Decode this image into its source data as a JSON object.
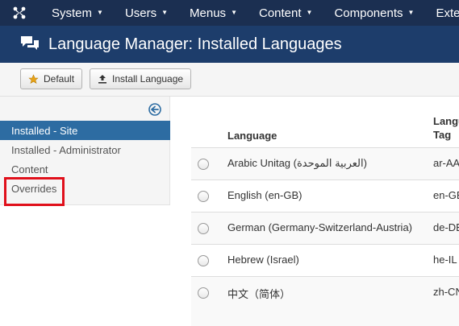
{
  "topnav": {
    "items": [
      {
        "label": "System"
      },
      {
        "label": "Users"
      },
      {
        "label": "Menus"
      },
      {
        "label": "Content"
      },
      {
        "label": "Components"
      },
      {
        "label": "Extensions"
      }
    ]
  },
  "header": {
    "title": "Language Manager: Installed Languages"
  },
  "toolbar": {
    "default_label": "Default",
    "install_label": "Install Language"
  },
  "sidebar": {
    "items": [
      {
        "label": "Installed - Site",
        "active": true
      },
      {
        "label": "Installed - Administrator",
        "active": false
      },
      {
        "label": "Content",
        "active": false
      },
      {
        "label": "Overrides",
        "active": false
      }
    ]
  },
  "table": {
    "headers": {
      "language": "Language",
      "tag_line1": "Language",
      "tag_line2": "Tag"
    },
    "rows": [
      {
        "language": "Arabic Unitag (العربية الموحدة)",
        "tag": "ar-AA"
      },
      {
        "language": "English (en-GB)",
        "tag": "en-GB"
      },
      {
        "language": "German (Germany-Switzerland-Austria)",
        "tag": "de-DE"
      },
      {
        "language": "Hebrew (Israel)",
        "tag": "he-IL"
      },
      {
        "language": "中文（简体）",
        "tag": "zh-CN"
      }
    ]
  },
  "colors": {
    "topnav_bg": "#1b2f51",
    "header_bg": "#1d3d6b",
    "active_sidebar": "#2d6ca2",
    "highlight": "#e0101b"
  }
}
